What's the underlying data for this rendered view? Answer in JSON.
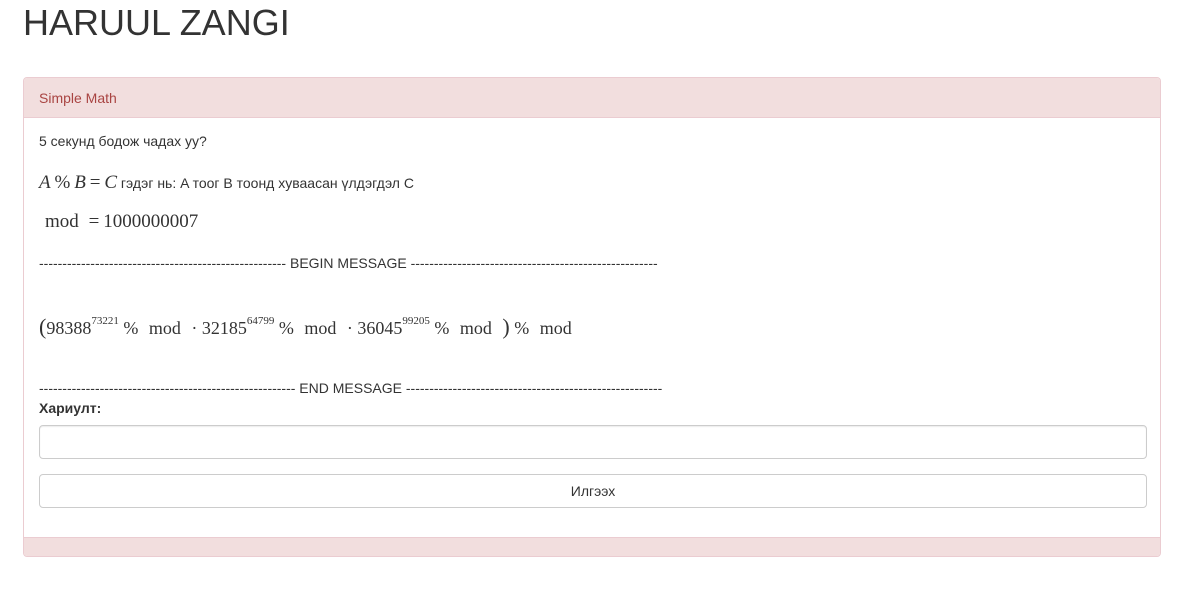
{
  "page": {
    "title": "HARUUL ZANGI"
  },
  "panel": {
    "heading": "Simple Math",
    "intro": "5 секунд бодож чадах уу?",
    "definition": {
      "A": "A",
      "percent": "%",
      "B": "B",
      "eq": "=",
      "C": "C",
      "text": "гэдэг нь: A тоог B тоонд хуваасан үлдэгдэл C"
    },
    "modulus": {
      "name": "mod",
      "eq": "=",
      "value": "1000000007"
    },
    "begin_divider": "----------------------------------------------------- BEGIN MESSAGE -----------------------------------------------------",
    "expression": {
      "open": "(",
      "terms": [
        {
          "base": "98388",
          "exp": "73221"
        },
        {
          "base": "32185",
          "exp": "64799"
        },
        {
          "base": "36045",
          "exp": "99205"
        }
      ],
      "percent": "%",
      "mod": "mod",
      "dot": "·",
      "close": ")"
    },
    "end_divider": "------------------------------------------------------- END MESSAGE -------------------------------------------------------",
    "answer_label": "Хариулт:",
    "answer_value": "",
    "submit_label": "Илгээх"
  }
}
